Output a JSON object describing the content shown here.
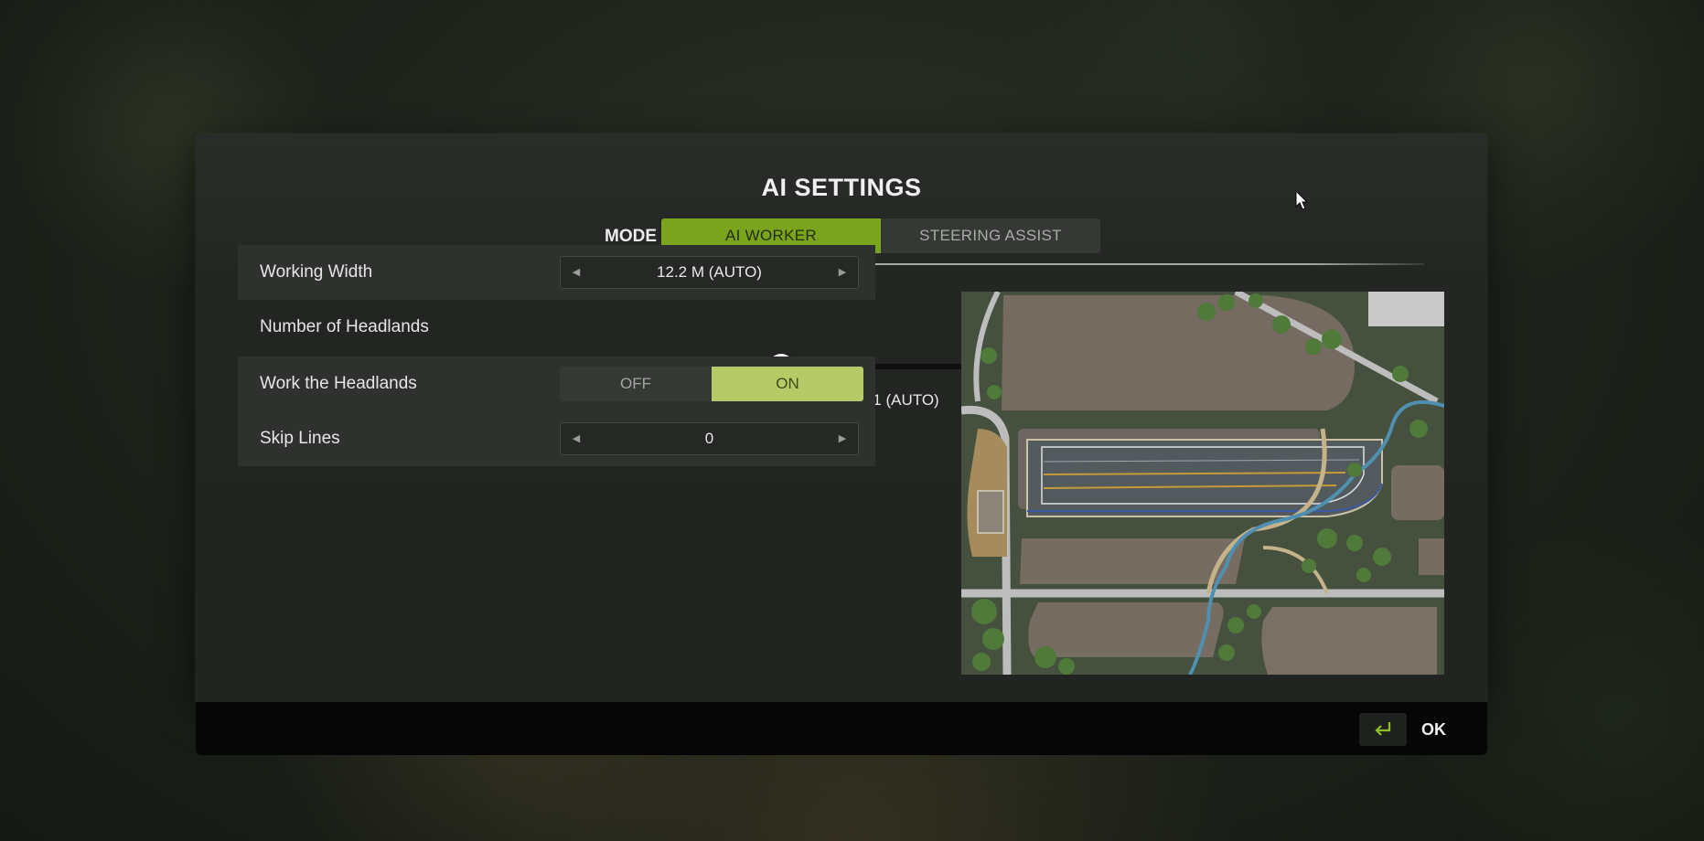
{
  "dialog": {
    "title": "AI SETTINGS",
    "mode_label": "MODE",
    "modes": [
      {
        "label": "AI WORKER",
        "selected": true
      },
      {
        "label": "STEERING ASSIST",
        "selected": false
      }
    ],
    "accent_color": "#7aa31e",
    "toggle_on_color": "#b7ca67"
  },
  "settings": {
    "working_width": {
      "label": "Working Width",
      "value": "12.2 M (AUTO)"
    },
    "headlands": {
      "label": "Number of Headlands",
      "value": "1 (AUTO)",
      "slider_fraction": 0.08
    },
    "work_headlands": {
      "label": "Work the Headlands",
      "off_label": "OFF",
      "on_label": "ON",
      "state": "ON"
    },
    "skip_lines": {
      "label": "Skip Lines",
      "value": "0"
    }
  },
  "footer": {
    "ok_label": "OK",
    "ok_icon": "enter-key-icon"
  },
  "map": {
    "icon": "field-map-preview"
  }
}
